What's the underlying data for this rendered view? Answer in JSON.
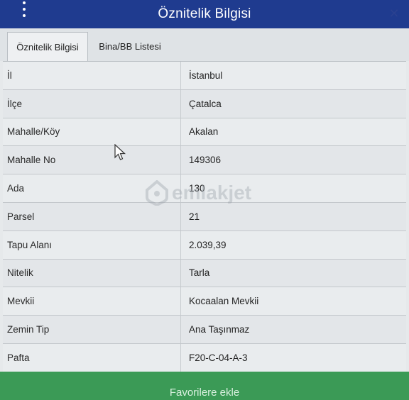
{
  "header": {
    "title": "Öznitelik Bilgisi",
    "menu_icon": "vertical-dots-icon",
    "close_icon": "close-icon"
  },
  "tabs": [
    {
      "label": "Öznitelik Bilgisi",
      "active": true
    },
    {
      "label": "Bina/BB Listesi",
      "active": false
    }
  ],
  "rows": [
    {
      "key": "İl",
      "value": "İstanbul"
    },
    {
      "key": "İlçe",
      "value": "Çatalca"
    },
    {
      "key": "Mahalle/Köy",
      "value": "Akalan"
    },
    {
      "key": "Mahalle No",
      "value": "149306"
    },
    {
      "key": "Ada",
      "value": "130"
    },
    {
      "key": "Parsel",
      "value": "21"
    },
    {
      "key": "Tapu Alanı",
      "value": "2.039,39"
    },
    {
      "key": "Nitelik",
      "value": "Tarla"
    },
    {
      "key": "Mevkii",
      "value": "Kocaalan Mevkii"
    },
    {
      "key": "Zemin Tip",
      "value": "Ana Taşınmaz"
    },
    {
      "key": "Pafta",
      "value": "F20-C-04-A-3"
    }
  ],
  "watermark": "emlakjet",
  "favorite_button": {
    "label": "Favorilere ekle"
  },
  "colors": {
    "header": "#1f3b8f",
    "button": "#3b9a56"
  }
}
